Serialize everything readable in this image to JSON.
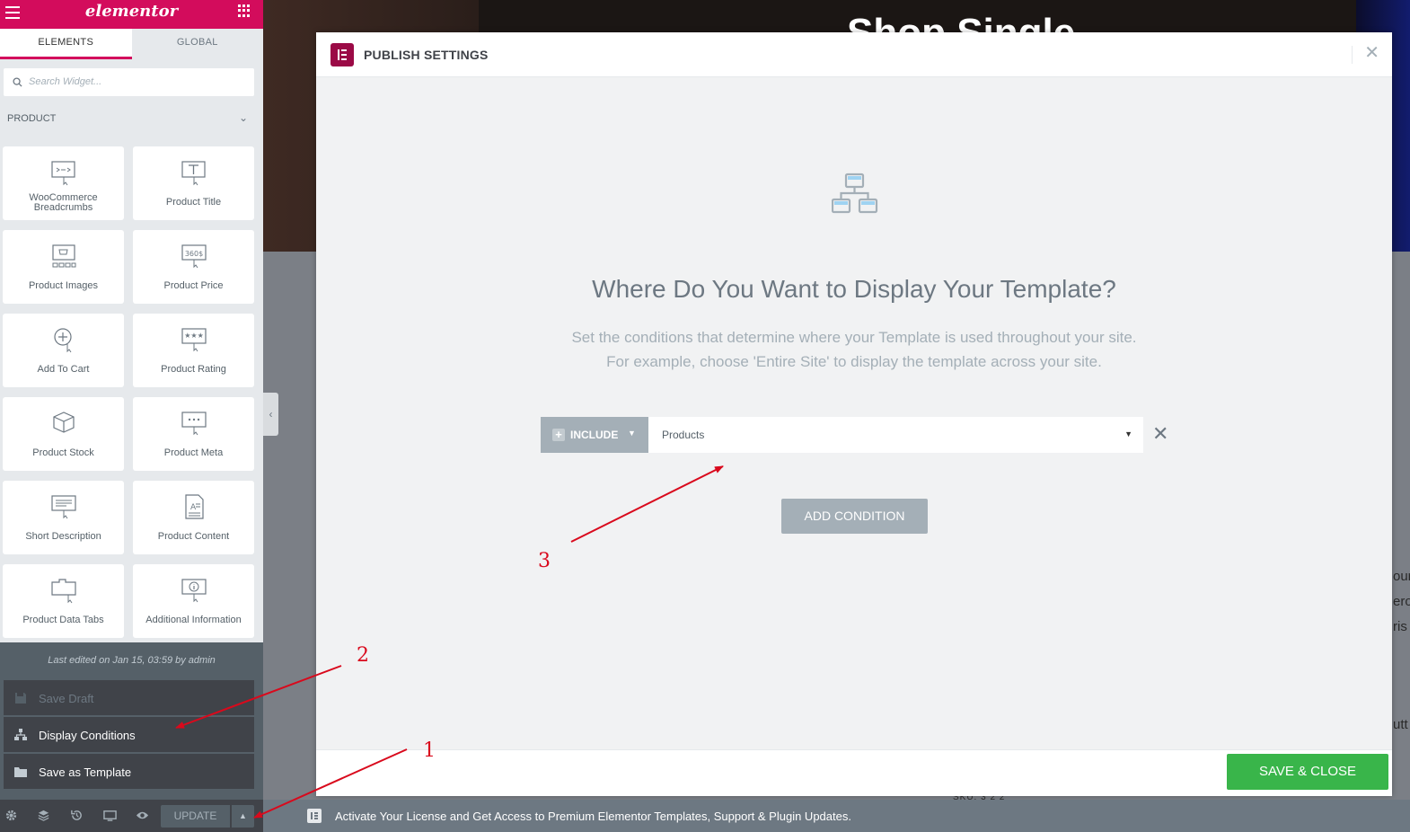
{
  "panel": {
    "logo": "elementor",
    "tabs": [
      "ELEMENTS",
      "GLOBAL"
    ],
    "search_placeholder": "Search Widget...",
    "category": "PRODUCT",
    "widgets": [
      {
        "label": "WooCommerce Breadcrumbs",
        "icon": "breadcrumbs-icon"
      },
      {
        "label": "Product Title",
        "icon": "title-icon"
      },
      {
        "label": "Product Images",
        "icon": "images-icon"
      },
      {
        "label": "Product Price",
        "icon": "price-icon"
      },
      {
        "label": "Add To Cart",
        "icon": "add-to-cart-icon"
      },
      {
        "label": "Product Rating",
        "icon": "rating-icon"
      },
      {
        "label": "Product Stock",
        "icon": "stock-icon"
      },
      {
        "label": "Product Meta",
        "icon": "meta-icon"
      },
      {
        "label": "Short Description",
        "icon": "short-description-icon"
      },
      {
        "label": "Product Content",
        "icon": "content-icon"
      },
      {
        "label": "Product Data Tabs",
        "icon": "data-tabs-icon"
      },
      {
        "label": "Additional Information",
        "icon": "info-icon"
      }
    ],
    "price_icon_text": "360$",
    "last_edited": "Last edited on Jan 15, 03:59 by admin",
    "menu": {
      "save_draft": "Save Draft",
      "display_conditions": "Display Conditions",
      "save_as_template": "Save as Template"
    },
    "footer": {
      "update": "UPDATE"
    }
  },
  "background": {
    "hero_title": "Shop Single",
    "side_text": [
      "our",
      "ero",
      "ris",
      "utt"
    ],
    "lower_text": "SKU: 3 2 2"
  },
  "modal": {
    "title": "PUBLISH SETTINGS",
    "heading": "Where Do You Want to Display Your Template?",
    "desc_line1": "Set the conditions that determine where your Template is used throughout your site.",
    "desc_line2": "For example, choose 'Entire Site' to display the template across your site.",
    "condition": {
      "type": "INCLUDE",
      "value": "Products"
    },
    "add_condition": "ADD CONDITION",
    "save_close": "SAVE & CLOSE"
  },
  "notice": {
    "text": "Activate Your License and Get Access to Premium Elementor Templates, Support & Plugin Updates."
  },
  "annotations": {
    "color": "#d9091c",
    "labels": [
      "1",
      "2",
      "3"
    ]
  },
  "colors": {
    "brand": "#d30c5c",
    "success": "#39b54a",
    "muted": "#a4afb7"
  }
}
